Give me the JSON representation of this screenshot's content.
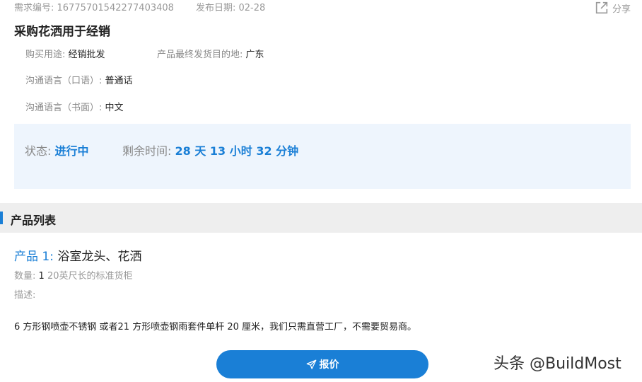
{
  "meta": {
    "req_no": "需求编号: 16775701542277403408",
    "pub_date": "发布日期: 02-28"
  },
  "share": {
    "label": "分享",
    "icon": "share-icon"
  },
  "title": "采购花洒用于经销",
  "info": {
    "purpose_key": "购买用途:",
    "purpose_val": "经销批发",
    "dest_key": "产品最终发货目的地:",
    "dest_val": "广东",
    "spoken_key": "沟通语言（口语）:",
    "spoken_val": "普通话",
    "written_key": "沟通语言（书面）:",
    "written_val": "中文"
  },
  "status": {
    "state_key": "状态:",
    "state_val": "进行中",
    "remain_key": "剩余时间:",
    "remain_val": "28 天 13 小时 32 分钟"
  },
  "section": {
    "label": "产品列表"
  },
  "product": {
    "num": "产品 1:",
    "name": "浴室龙头、花洒",
    "qty_key": "数量:",
    "qty_val": "1",
    "qty_unit": "20英尺长的标准货柜",
    "desc_key": "描述:",
    "desc_val": "6 方形钢喷壶不锈钢 或者21 方形喷壶钢雨套件单杆 20 厘米，我们只需直营工厂，不需要贸易商。"
  },
  "quote_button": {
    "label": "报价",
    "icon": "send-icon"
  },
  "watermark": "头条 @BuildMost",
  "colors": {
    "accent": "#1a7fd6",
    "status_bg": "#eef5fd",
    "section_bg": "#eeeeee"
  }
}
